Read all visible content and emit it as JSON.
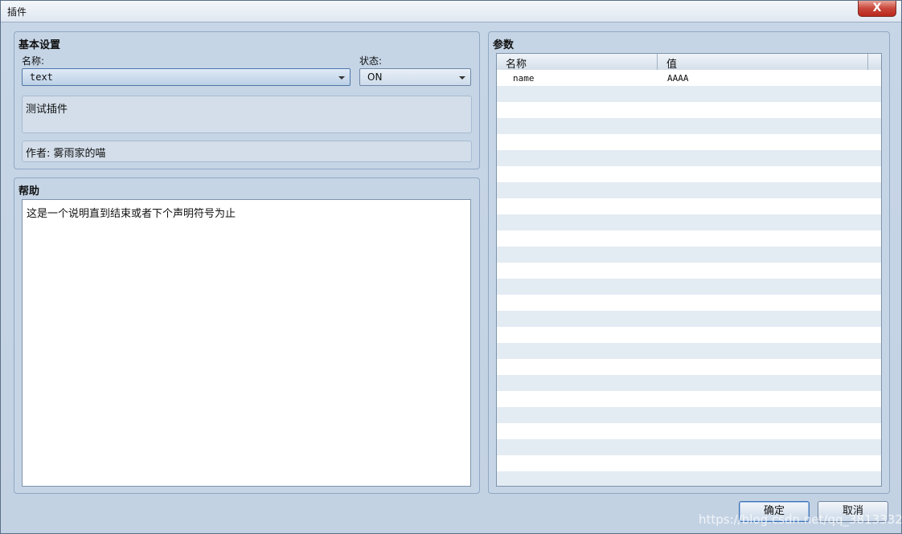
{
  "window": {
    "title": "插件",
    "close_label": "X"
  },
  "basic": {
    "title": "基本设置",
    "name_label": "名称:",
    "name_value": "text",
    "status_label": "状态:",
    "status_value": "ON",
    "description": "测试插件",
    "author": "作者: 雾雨家的喵"
  },
  "help": {
    "title": "帮助",
    "text": "这是一个说明直到结束或者下个声明符号为止"
  },
  "params": {
    "title": "参数",
    "columns": [
      "名称",
      "值"
    ],
    "rows": [
      {
        "name": "name",
        "value": "AAAA"
      }
    ],
    "total_rows": 26
  },
  "buttons": {
    "ok": "确定",
    "cancel": "取消"
  },
  "watermark": "https://blog.csdn.net/qq_38133323"
}
